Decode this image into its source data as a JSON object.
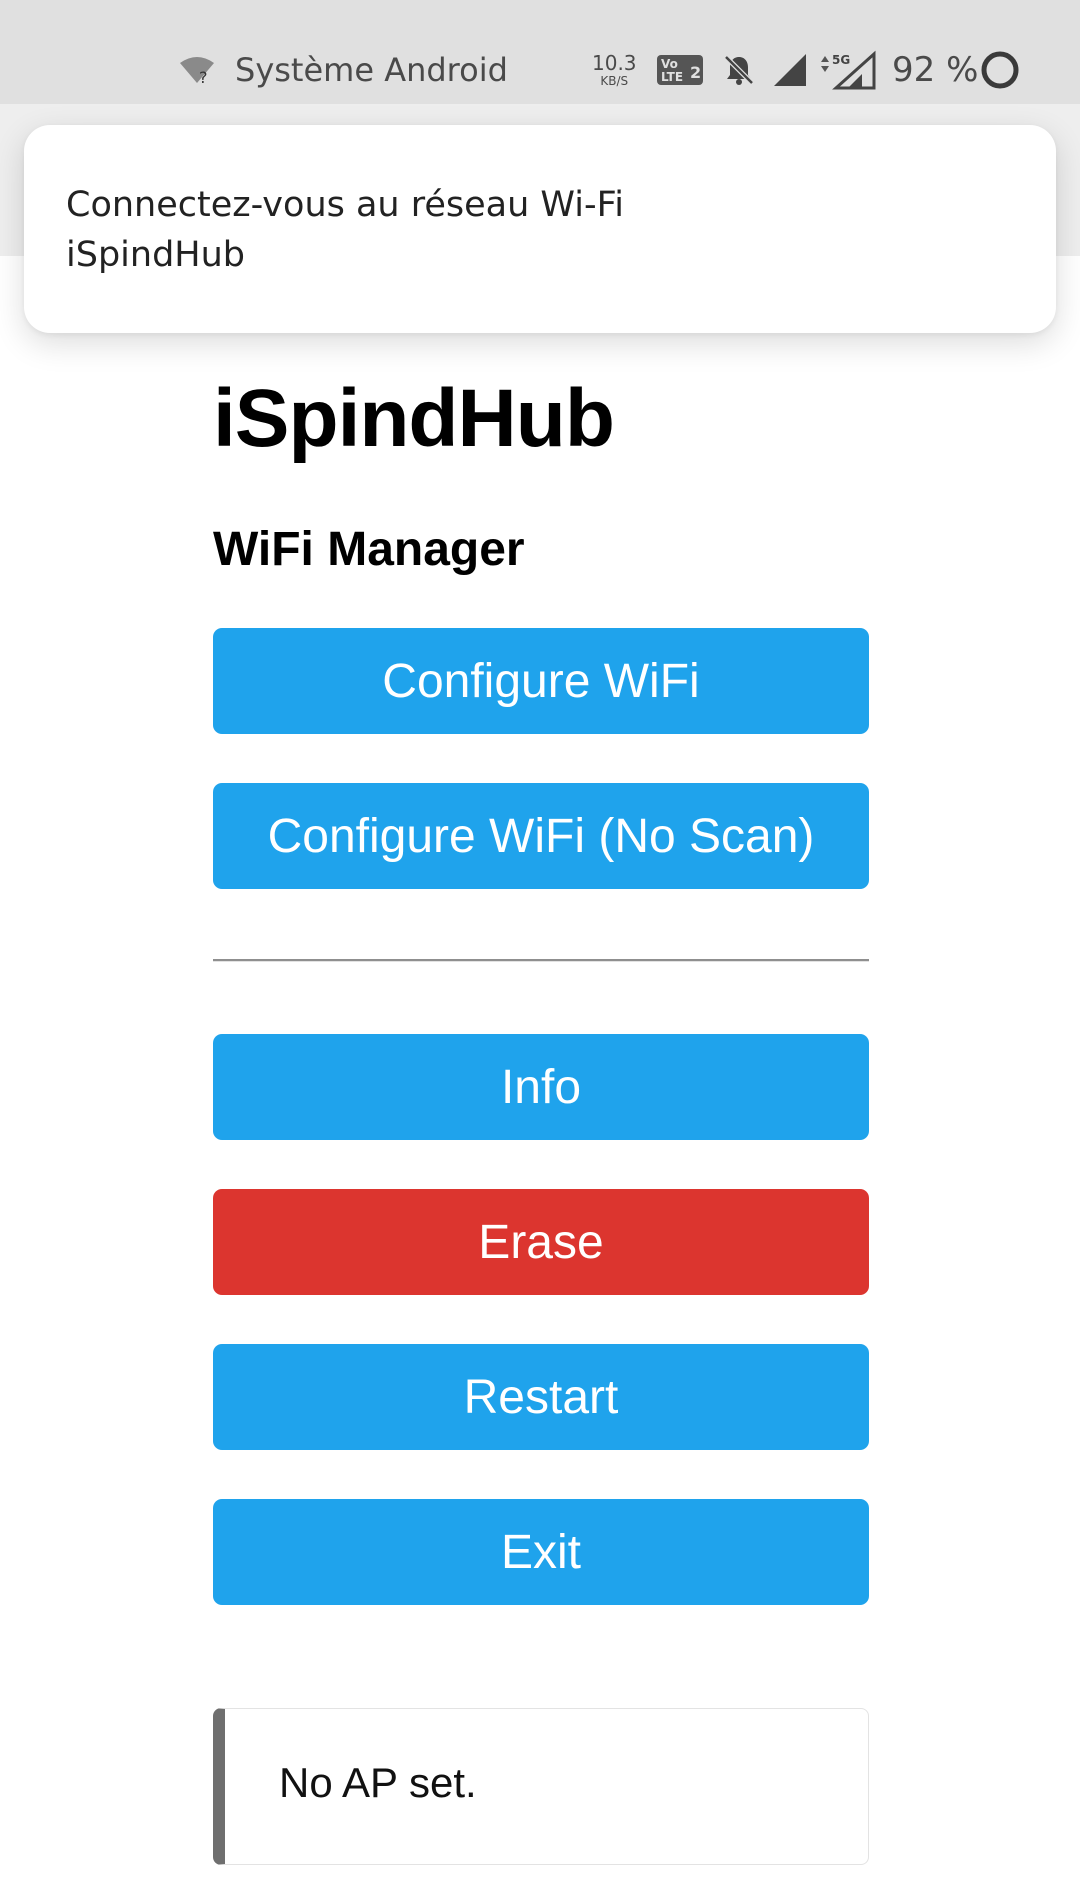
{
  "status_bar": {
    "notification_source": "Système Android",
    "network_speed_value": "10.3",
    "network_speed_unit": "KB/S",
    "volte_label": "Vo LTE2",
    "network_type": "5G",
    "battery_percent": "92 %",
    "icons": [
      "wifi-question-icon",
      "volte-icon",
      "bell-off-icon",
      "signal-icon",
      "signal-5g-icon",
      "battery-ring-icon"
    ]
  },
  "notification": {
    "title": "Connectez-vous au réseau Wi-Fi",
    "body": "iSpindHub"
  },
  "page": {
    "title": "iSpindHub",
    "subtitle": "WiFi Manager"
  },
  "buttons": {
    "configure_wifi": "Configure WiFi",
    "configure_wifi_noscan": "Configure WiFi (No Scan)",
    "info": "Info",
    "erase": "Erase",
    "restart": "Restart",
    "exit": "Exit"
  },
  "status_message": "No AP set.",
  "colors": {
    "button_primary": "#1fa3ec",
    "button_danger": "#dc352f",
    "status_bar_bg": "#e0e0e0",
    "message_border": "#6f6f6f"
  }
}
